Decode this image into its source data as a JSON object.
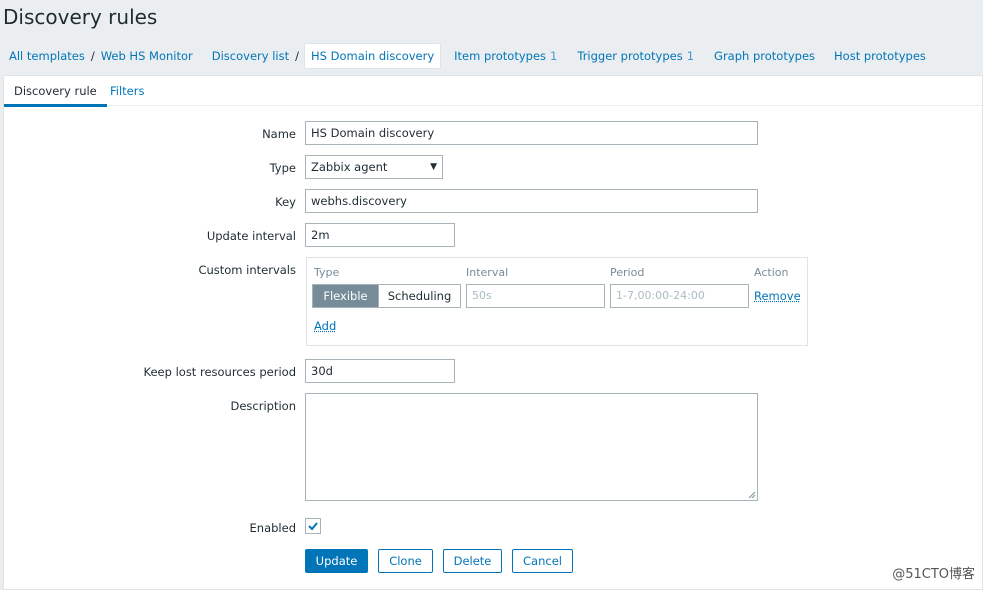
{
  "page": {
    "title": "Discovery rules"
  },
  "breadcrumb": {
    "items": [
      {
        "label": "All templates"
      },
      {
        "label": "Web HS Monitor"
      },
      {
        "label": "Discovery list"
      },
      {
        "label": "HS Domain discovery"
      }
    ],
    "links": [
      {
        "label": "Item prototypes",
        "count": "1"
      },
      {
        "label": "Trigger prototypes",
        "count": "1"
      },
      {
        "label": "Graph prototypes",
        "count": ""
      },
      {
        "label": "Host prototypes",
        "count": ""
      }
    ]
  },
  "tabs": [
    {
      "label": "Discovery rule",
      "active": true
    },
    {
      "label": "Filters",
      "active": false
    }
  ],
  "form": {
    "name": {
      "label": "Name",
      "value": "HS Domain discovery"
    },
    "type": {
      "label": "Type",
      "value": "Zabbix agent"
    },
    "key": {
      "label": "Key",
      "value": "webhs.discovery"
    },
    "update_interval": {
      "label": "Update interval",
      "value": "2m"
    },
    "custom_intervals": {
      "label": "Custom intervals",
      "headers": {
        "type": "Type",
        "interval": "Interval",
        "period": "Period",
        "action": "Action"
      },
      "row": {
        "flexible": "Flexible",
        "scheduling": "Scheduling",
        "interval_placeholder": "50s",
        "period_placeholder": "1-7,00:00-24:00",
        "remove": "Remove"
      },
      "add": "Add"
    },
    "keep_lost": {
      "label": "Keep lost resources period",
      "value": "30d"
    },
    "description": {
      "label": "Description",
      "value": ""
    },
    "enabled": {
      "label": "Enabled",
      "checked": true
    }
  },
  "buttons": {
    "update": "Update",
    "clone": "Clone",
    "delete": "Delete",
    "cancel": "Cancel"
  },
  "watermark": "@51CTO博客",
  "colors": {
    "accent": "#0275b8",
    "background": "#ebeef0",
    "segment_active": "#768d99"
  }
}
